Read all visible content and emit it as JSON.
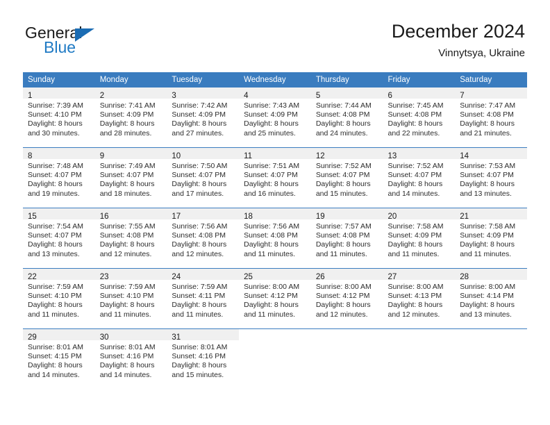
{
  "brand": {
    "name_part1": "General",
    "name_part2": "Blue",
    "flag_icon": "triangle-flag-icon",
    "accent_color": "#1b6cb3"
  },
  "header": {
    "title": "December 2024",
    "subtitle": "Vinnytsya, Ukraine"
  },
  "theme": {
    "header_bg": "#3a7cbf",
    "daynum_bg": "#f0f0f0",
    "text": "#2b2b2b"
  },
  "calendar": {
    "weekday_headers": [
      "Sunday",
      "Monday",
      "Tuesday",
      "Wednesday",
      "Thursday",
      "Friday",
      "Saturday"
    ],
    "weeks": [
      {
        "days": [
          {
            "date": "1",
            "sunrise": "Sunrise: 7:39 AM",
            "sunset": "Sunset: 4:10 PM",
            "daylight1": "Daylight: 8 hours",
            "daylight2": "and 30 minutes."
          },
          {
            "date": "2",
            "sunrise": "Sunrise: 7:41 AM",
            "sunset": "Sunset: 4:09 PM",
            "daylight1": "Daylight: 8 hours",
            "daylight2": "and 28 minutes."
          },
          {
            "date": "3",
            "sunrise": "Sunrise: 7:42 AM",
            "sunset": "Sunset: 4:09 PM",
            "daylight1": "Daylight: 8 hours",
            "daylight2": "and 27 minutes."
          },
          {
            "date": "4",
            "sunrise": "Sunrise: 7:43 AM",
            "sunset": "Sunset: 4:09 PM",
            "daylight1": "Daylight: 8 hours",
            "daylight2": "and 25 minutes."
          },
          {
            "date": "5",
            "sunrise": "Sunrise: 7:44 AM",
            "sunset": "Sunset: 4:08 PM",
            "daylight1": "Daylight: 8 hours",
            "daylight2": "and 24 minutes."
          },
          {
            "date": "6",
            "sunrise": "Sunrise: 7:45 AM",
            "sunset": "Sunset: 4:08 PM",
            "daylight1": "Daylight: 8 hours",
            "daylight2": "and 22 minutes."
          },
          {
            "date": "7",
            "sunrise": "Sunrise: 7:47 AM",
            "sunset": "Sunset: 4:08 PM",
            "daylight1": "Daylight: 8 hours",
            "daylight2": "and 21 minutes."
          }
        ]
      },
      {
        "days": [
          {
            "date": "8",
            "sunrise": "Sunrise: 7:48 AM",
            "sunset": "Sunset: 4:07 PM",
            "daylight1": "Daylight: 8 hours",
            "daylight2": "and 19 minutes."
          },
          {
            "date": "9",
            "sunrise": "Sunrise: 7:49 AM",
            "sunset": "Sunset: 4:07 PM",
            "daylight1": "Daylight: 8 hours",
            "daylight2": "and 18 minutes."
          },
          {
            "date": "10",
            "sunrise": "Sunrise: 7:50 AM",
            "sunset": "Sunset: 4:07 PM",
            "daylight1": "Daylight: 8 hours",
            "daylight2": "and 17 minutes."
          },
          {
            "date": "11",
            "sunrise": "Sunrise: 7:51 AM",
            "sunset": "Sunset: 4:07 PM",
            "daylight1": "Daylight: 8 hours",
            "daylight2": "and 16 minutes."
          },
          {
            "date": "12",
            "sunrise": "Sunrise: 7:52 AM",
            "sunset": "Sunset: 4:07 PM",
            "daylight1": "Daylight: 8 hours",
            "daylight2": "and 15 minutes."
          },
          {
            "date": "13",
            "sunrise": "Sunrise: 7:52 AM",
            "sunset": "Sunset: 4:07 PM",
            "daylight1": "Daylight: 8 hours",
            "daylight2": "and 14 minutes."
          },
          {
            "date": "14",
            "sunrise": "Sunrise: 7:53 AM",
            "sunset": "Sunset: 4:07 PM",
            "daylight1": "Daylight: 8 hours",
            "daylight2": "and 13 minutes."
          }
        ]
      },
      {
        "days": [
          {
            "date": "15",
            "sunrise": "Sunrise: 7:54 AM",
            "sunset": "Sunset: 4:07 PM",
            "daylight1": "Daylight: 8 hours",
            "daylight2": "and 13 minutes."
          },
          {
            "date": "16",
            "sunrise": "Sunrise: 7:55 AM",
            "sunset": "Sunset: 4:08 PM",
            "daylight1": "Daylight: 8 hours",
            "daylight2": "and 12 minutes."
          },
          {
            "date": "17",
            "sunrise": "Sunrise: 7:56 AM",
            "sunset": "Sunset: 4:08 PM",
            "daylight1": "Daylight: 8 hours",
            "daylight2": "and 12 minutes."
          },
          {
            "date": "18",
            "sunrise": "Sunrise: 7:56 AM",
            "sunset": "Sunset: 4:08 PM",
            "daylight1": "Daylight: 8 hours",
            "daylight2": "and 11 minutes."
          },
          {
            "date": "19",
            "sunrise": "Sunrise: 7:57 AM",
            "sunset": "Sunset: 4:08 PM",
            "daylight1": "Daylight: 8 hours",
            "daylight2": "and 11 minutes."
          },
          {
            "date": "20",
            "sunrise": "Sunrise: 7:58 AM",
            "sunset": "Sunset: 4:09 PM",
            "daylight1": "Daylight: 8 hours",
            "daylight2": "and 11 minutes."
          },
          {
            "date": "21",
            "sunrise": "Sunrise: 7:58 AM",
            "sunset": "Sunset: 4:09 PM",
            "daylight1": "Daylight: 8 hours",
            "daylight2": "and 11 minutes."
          }
        ]
      },
      {
        "days": [
          {
            "date": "22",
            "sunrise": "Sunrise: 7:59 AM",
            "sunset": "Sunset: 4:10 PM",
            "daylight1": "Daylight: 8 hours",
            "daylight2": "and 11 minutes."
          },
          {
            "date": "23",
            "sunrise": "Sunrise: 7:59 AM",
            "sunset": "Sunset: 4:10 PM",
            "daylight1": "Daylight: 8 hours",
            "daylight2": "and 11 minutes."
          },
          {
            "date": "24",
            "sunrise": "Sunrise: 7:59 AM",
            "sunset": "Sunset: 4:11 PM",
            "daylight1": "Daylight: 8 hours",
            "daylight2": "and 11 minutes."
          },
          {
            "date": "25",
            "sunrise": "Sunrise: 8:00 AM",
            "sunset": "Sunset: 4:12 PM",
            "daylight1": "Daylight: 8 hours",
            "daylight2": "and 11 minutes."
          },
          {
            "date": "26",
            "sunrise": "Sunrise: 8:00 AM",
            "sunset": "Sunset: 4:12 PM",
            "daylight1": "Daylight: 8 hours",
            "daylight2": "and 12 minutes."
          },
          {
            "date": "27",
            "sunrise": "Sunrise: 8:00 AM",
            "sunset": "Sunset: 4:13 PM",
            "daylight1": "Daylight: 8 hours",
            "daylight2": "and 12 minutes."
          },
          {
            "date": "28",
            "sunrise": "Sunrise: 8:00 AM",
            "sunset": "Sunset: 4:14 PM",
            "daylight1": "Daylight: 8 hours",
            "daylight2": "and 13 minutes."
          }
        ]
      },
      {
        "days": [
          {
            "date": "29",
            "sunrise": "Sunrise: 8:01 AM",
            "sunset": "Sunset: 4:15 PM",
            "daylight1": "Daylight: 8 hours",
            "daylight2": "and 14 minutes."
          },
          {
            "date": "30",
            "sunrise": "Sunrise: 8:01 AM",
            "sunset": "Sunset: 4:16 PM",
            "daylight1": "Daylight: 8 hours",
            "daylight2": "and 14 minutes."
          },
          {
            "date": "31",
            "sunrise": "Sunrise: 8:01 AM",
            "sunset": "Sunset: 4:16 PM",
            "daylight1": "Daylight: 8 hours",
            "daylight2": "and 15 minutes."
          },
          {
            "date": "",
            "sunrise": "",
            "sunset": "",
            "daylight1": "",
            "daylight2": ""
          },
          {
            "date": "",
            "sunrise": "",
            "sunset": "",
            "daylight1": "",
            "daylight2": ""
          },
          {
            "date": "",
            "sunrise": "",
            "sunset": "",
            "daylight1": "",
            "daylight2": ""
          },
          {
            "date": "",
            "sunrise": "",
            "sunset": "",
            "daylight1": "",
            "daylight2": ""
          }
        ]
      }
    ]
  }
}
